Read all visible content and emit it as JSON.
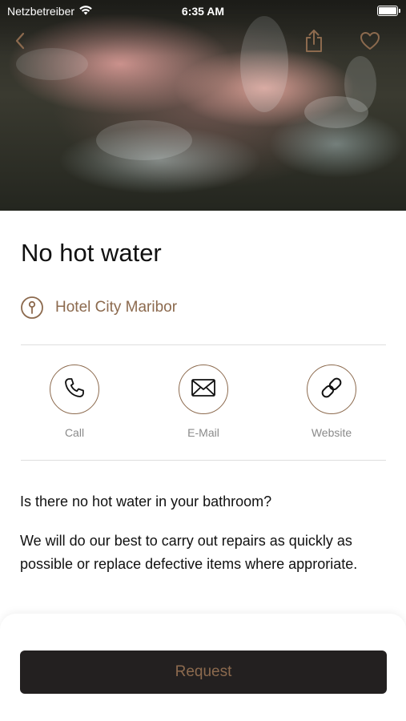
{
  "status_bar": {
    "carrier": "Netzbetreiber",
    "time": "6:35 AM"
  },
  "hero": {
    "back_icon": "chevron-left-icon",
    "share_icon": "share-icon",
    "favorite_icon": "heart-icon"
  },
  "service": {
    "title": "No hot water",
    "location": "Hotel City Maribor",
    "location_icon": "keyhole-pin-icon"
  },
  "actions": [
    {
      "label": "Call",
      "icon": "phone-icon"
    },
    {
      "label": "E-Mail",
      "icon": "envelope-icon"
    },
    {
      "label": "Website",
      "icon": "link-icon"
    }
  ],
  "description": {
    "question": "Is there no hot water in your bathroom?",
    "body": "We will do our best to carry out repairs as quickly as possible or replace defective items where approriate."
  },
  "footer": {
    "request_label": "Request"
  },
  "colors": {
    "accent": "#8c6a4e",
    "button_bg": "#232020",
    "divider": "#dedede",
    "muted_text": "#8a8a8a"
  }
}
